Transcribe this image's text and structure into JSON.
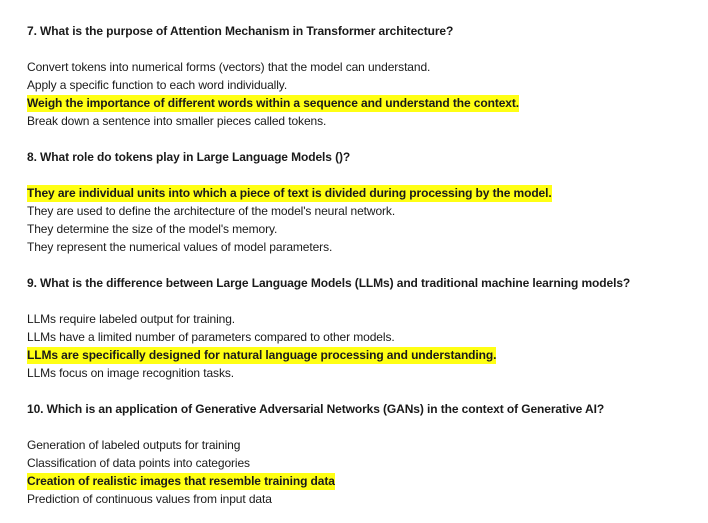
{
  "questions": [
    {
      "title": "7. What is the purpose of Attention Mechanism in Transformer architecture?",
      "options": [
        {
          "text": "Convert tokens into numerical forms (vectors) that the model can understand.",
          "correct": false
        },
        {
          "text": "Apply a specific function to each word individually.",
          "correct": false
        },
        {
          "text": "Weigh the importance of different words within a sequence and understand the context.",
          "correct": true
        },
        {
          "text": "Break down a sentence into smaller pieces called tokens.",
          "correct": false
        }
      ]
    },
    {
      "title": "8. What role do tokens play in Large Language Models ()?",
      "options": [
        {
          "text": "They are individual units into which a piece of text is divided during processing by the model.",
          "correct": true
        },
        {
          "text": "They are used to define the architecture of the model's neural network.",
          "correct": false
        },
        {
          "text": "They determine the size of the model's memory.",
          "correct": false
        },
        {
          "text": "They represent the numerical values of model parameters.",
          "correct": false
        }
      ]
    },
    {
      "title": "9. What is the difference between Large Language Models (LLMs) and traditional machine learning models?",
      "options": [
        {
          "text": "LLMs require labeled output for training.",
          "correct": false
        },
        {
          "text": "LLMs have a limited number of parameters compared to other models.",
          "correct": false
        },
        {
          "text": "LLMs are specifically designed for natural language processing and understanding.",
          "correct": true
        },
        {
          "text": "LLMs focus on image recognition tasks.",
          "correct": false
        }
      ]
    },
    {
      "title": "10. Which is an application of Generative Adversarial Networks (GANs) in the context of Generative AI?",
      "options": [
        {
          "text": "Generation of labeled outputs for training",
          "correct": false
        },
        {
          "text": "Classification of data points into categories",
          "correct": false
        },
        {
          "text": "Creation of realistic images that resemble training data",
          "correct": true
        },
        {
          "text": "Prediction of continuous values from input data",
          "correct": false
        }
      ]
    }
  ],
  "colors": {
    "highlight": "#ffff14",
    "text": "#1a1a1a"
  }
}
